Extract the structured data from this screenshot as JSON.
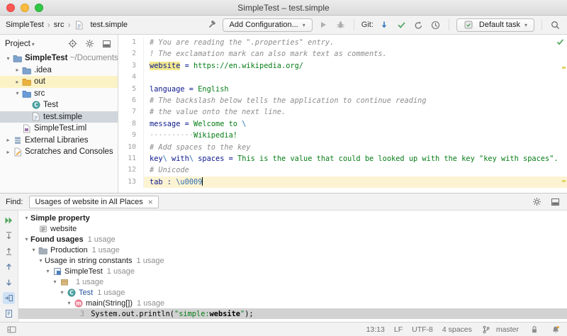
{
  "window": {
    "title": "SimpleTest – test.simple"
  },
  "toolbar": {
    "breadcrumbs": [
      "SimpleTest",
      "src",
      "test.simple"
    ],
    "add_configuration": "Add Configuration...",
    "git_label": "Git:",
    "default_task": "Default task"
  },
  "project_panel": {
    "title": "Project",
    "tree": [
      {
        "level": 0,
        "arrow": "open",
        "icon": "folder_blue",
        "label": "SimpleTest",
        "bold": true,
        "suffix": "~/Documents/"
      },
      {
        "level": 1,
        "arrow": "closed",
        "icon": "folder_blue",
        "label": ".idea"
      },
      {
        "level": 1,
        "arrow": "closed",
        "icon": "folder_orange",
        "label": "out",
        "excluded": true
      },
      {
        "level": 1,
        "arrow": "open",
        "icon": "folder_src",
        "label": "src"
      },
      {
        "level": 2,
        "arrow": "none",
        "icon": "cls",
        "label": "Test"
      },
      {
        "level": 2,
        "arrow": "none",
        "icon": "pfile",
        "label": "test.simple",
        "selected": true
      },
      {
        "level": 1,
        "arrow": "none",
        "icon": "iml",
        "label": "SimpleTest.iml"
      },
      {
        "level": 0,
        "arrow": "closed",
        "icon": "lib",
        "label": "External Libraries"
      },
      {
        "level": 0,
        "arrow": "closed",
        "icon": "scr",
        "label": "Scratches and Consoles"
      }
    ]
  },
  "editor": {
    "lines": [
      {
        "n": 1,
        "seg": [
          [
            "c",
            "# You are reading the \".properties\" entry."
          ]
        ]
      },
      {
        "n": 2,
        "seg": [
          [
            "c",
            "! The exclamation mark can also mark text as comments."
          ]
        ]
      },
      {
        "n": 3,
        "seg": [
          [
            "kh",
            "website"
          ],
          [
            "s",
            " = "
          ],
          [
            "v",
            "https://en.wikipedia.org/"
          ]
        ]
      },
      {
        "n": 4,
        "seg": []
      },
      {
        "n": 5,
        "seg": [
          [
            "k",
            "language"
          ],
          [
            "s",
            " = "
          ],
          [
            "v",
            "English"
          ]
        ]
      },
      {
        "n": 6,
        "seg": [
          [
            "c",
            "# The backslash below tells the application to continue reading"
          ]
        ]
      },
      {
        "n": 7,
        "seg": [
          [
            "c",
            "# the value onto the next line."
          ]
        ]
      },
      {
        "n": 8,
        "seg": [
          [
            "k",
            "message"
          ],
          [
            "s",
            " = "
          ],
          [
            "v",
            "Welcome to "
          ],
          [
            "e",
            "\\"
          ]
        ]
      },
      {
        "n": 9,
        "seg": [
          [
            "w",
            "··········"
          ],
          [
            "v",
            "Wikipedia!"
          ]
        ]
      },
      {
        "n": 10,
        "seg": [
          [
            "c",
            "# Add spaces to the key"
          ]
        ]
      },
      {
        "n": 11,
        "seg": [
          [
            "k",
            "key"
          ],
          [
            "e",
            "\\ "
          ],
          [
            "k",
            "with"
          ],
          [
            "e",
            "\\ "
          ],
          [
            "k",
            "spaces"
          ],
          [
            "s",
            " = "
          ],
          [
            "v",
            "This is the value that could be looked up with the key \"key with spaces\"."
          ]
        ]
      },
      {
        "n": 12,
        "seg": [
          [
            "c",
            "# Unicode"
          ]
        ]
      },
      {
        "n": 13,
        "current": true,
        "seg": [
          [
            "k",
            "tab"
          ],
          [
            "s",
            " : "
          ],
          [
            "e",
            "\\u0009"
          ],
          [
            "caret",
            ""
          ]
        ]
      }
    ]
  },
  "find_panel": {
    "label": "Find:",
    "tab_title": "Usages of website in All Places",
    "tab_close": "×",
    "toolbar_icons": [
      {
        "name": "rerun"
      },
      {
        "name": "expand-all"
      },
      {
        "name": "collapse-all"
      },
      {
        "name": "previous-occurrence"
      },
      {
        "name": "next-occurrence"
      },
      {
        "name": "autoscroll-to-source",
        "on": true
      },
      {
        "name": "preview-usages"
      }
    ],
    "tree": [
      {
        "level": 0,
        "arrow": "open",
        "label": "Simple property",
        "bold": true
      },
      {
        "level": 1,
        "arrow": "none",
        "icon": "prop",
        "label": "website"
      },
      {
        "level": 0,
        "arrow": "open",
        "label": "Found usages",
        "bold": true,
        "count": "1 usage"
      },
      {
        "level": 1,
        "arrow": "open",
        "icon": "folder_gray",
        "label": "Production",
        "count": "1 usage"
      },
      {
        "level": 2,
        "arrow": "open",
        "label": "Usage in string constants",
        "count": "1 usage"
      },
      {
        "level": 3,
        "arrow": "open",
        "icon": "mod",
        "label": "SimpleTest",
        "count": "1 usage"
      },
      {
        "level": 4,
        "arrow": "open",
        "icon": "pkg",
        "label": "",
        "count": "1 usage"
      },
      {
        "level": 5,
        "arrow": "open",
        "icon": "cls",
        "label": "Test",
        "blue": true,
        "count": "1 usage"
      },
      {
        "level": 6,
        "arrow": "open",
        "icon": "mth",
        "label": "main(String[])",
        "count": "1 usage"
      },
      {
        "level": 7,
        "arrow": "none",
        "selected": true,
        "code": {
          "line": "3",
          "segments": [
            [
              "plain",
              "System.out.println("
            ],
            [
              "str",
              "\"simple:"
            ],
            [
              "match",
              "website"
            ],
            [
              "str",
              "\""
            ],
            [
              "plain",
              ");"
            ]
          ]
        }
      }
    ]
  },
  "status_bar": {
    "caret_position": "13:13",
    "line_separator": "LF",
    "encoding": "UTF-8",
    "indent": "4 spaces",
    "branch": "master"
  }
}
